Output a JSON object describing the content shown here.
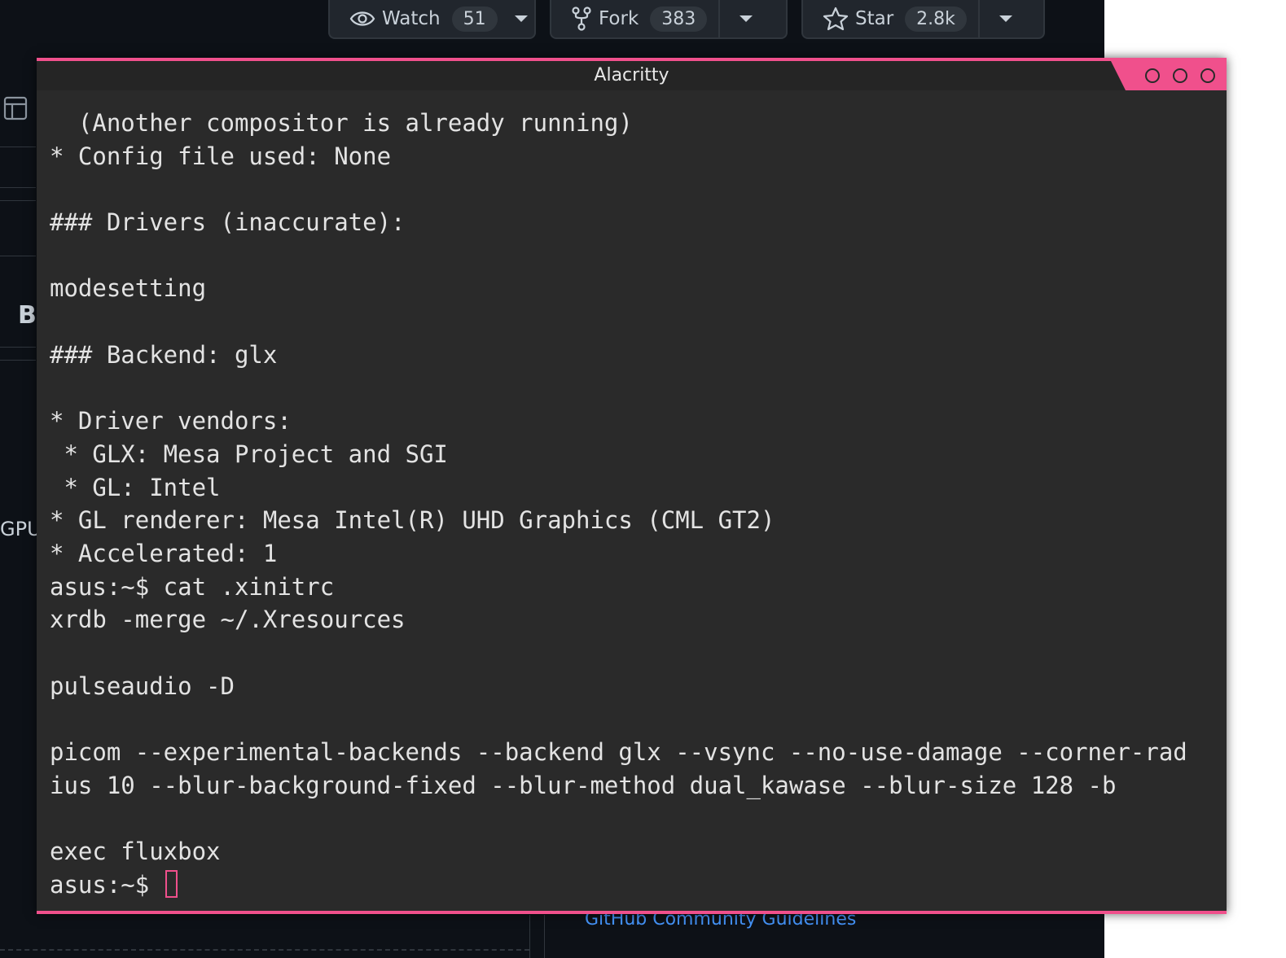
{
  "background_page": {
    "gpu_fragment": "GPU",
    "b_fragment": "B",
    "community_link": "GitHub Community Guidelines"
  },
  "repo_actions": {
    "watch": {
      "label": "Watch",
      "count": "51",
      "icon": "eye-icon"
    },
    "fork": {
      "label": "Fork",
      "count": "383",
      "icon": "repo-forked-icon"
    },
    "star": {
      "label": "Star",
      "count": "2.8k",
      "icon": "star-icon"
    }
  },
  "terminal": {
    "title": "Alacritty",
    "accent_color": "#f0508c",
    "background_color": "#2a2a2a",
    "lines": [
      "  (Another compositor is already running)",
      "* Config file used: None",
      "",
      "### Drivers (inaccurate):",
      "",
      "modesetting",
      "",
      "### Backend: glx",
      "",
      "* Driver vendors:",
      " * GLX: Mesa Project and SGI",
      " * GL: Intel",
      "* GL renderer: Mesa Intel(R) UHD Graphics (CML GT2)",
      "* Accelerated: 1",
      "asus:~$ cat .xinitrc",
      "xrdb -merge ~/.Xresources",
      "",
      "pulseaudio -D",
      "",
      "picom --experimental-backends --backend glx --vsync --no-use-damage --corner-rad",
      "ius 10 --blur-background-fixed --blur-method dual_kawase --blur-size 128 -b",
      "",
      "exec fluxbox"
    ],
    "prompt": "asus:~$ "
  }
}
